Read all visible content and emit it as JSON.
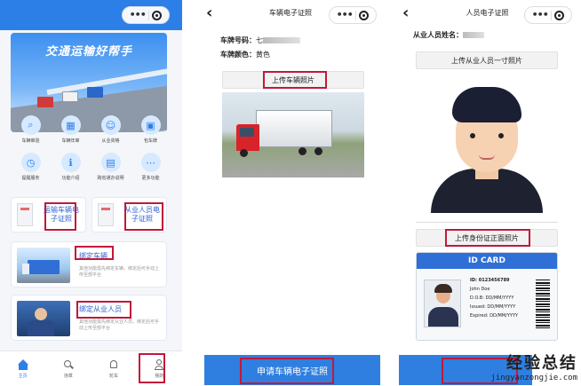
{
  "home": {
    "banner_title": "交通运输好帮手",
    "grid": [
      {
        "label": "车辆审验",
        "icon": "search-icon"
      },
      {
        "label": "车辆年审",
        "icon": "calendar-icon"
      },
      {
        "label": "从业资格",
        "icon": "person-icon"
      },
      {
        "label": "包车牌",
        "icon": "bus-icon"
      },
      {
        "label": "提醒服务",
        "icon": "alarm-icon"
      },
      {
        "label": "功能介绍",
        "icon": "info-icon"
      },
      {
        "label": "跨省通办说明",
        "icon": "document-icon"
      },
      {
        "label": "更多功能",
        "icon": "more-icon"
      }
    ],
    "card_vehicle_cert": "运输车辆电子证照",
    "card_person_cert": "从业人员电子证照",
    "bind_vehicle_title": "绑定车辆",
    "bind_vehicle_desc": "其他功能需先绑定车辆，绑定后可手动上传至部平台",
    "bind_person_title": "绑定从业人员",
    "bind_person_desc": "其他功能需先绑定从业人员，绑定后可手动上传至部平台",
    "tabs": [
      {
        "label": "主页",
        "icon": "home-icon"
      },
      {
        "label": "违章",
        "icon": "search-icon"
      },
      {
        "label": "轮车",
        "icon": "bell-icon"
      },
      {
        "label": "我的",
        "icon": "user-icon"
      }
    ]
  },
  "vehicle": {
    "title": "车辆电子证照",
    "plate_label": "车牌号码：",
    "plate_value": "七",
    "color_label": "车牌颜色：",
    "color_value": "黄色",
    "upload_label": "上传车辆照片",
    "submit_label": "申请车辆电子证照"
  },
  "person": {
    "title": "人员电子证照",
    "name_label": "从业人员姓名：",
    "upload_photo_label": "上传从业人员一寸照片",
    "upload_id_label": "上传身份证正面照片",
    "id_card": {
      "header": "ID CARD",
      "id_line": "ID: 0123456789",
      "name_line": "John Doe",
      "dob_line": "D.O.B: DD/MM/YYYY",
      "issued_line": "Issued: DD/MM/YYYY",
      "expired_line": "Expired: DD/MM/YYYY"
    },
    "watermark_cn": "经验总结",
    "watermark_url": "jingyanzongjie.com"
  },
  "colors": {
    "primary": "#2d7fe8",
    "highlight": "#c0193a",
    "button": "#2f7fe0"
  }
}
